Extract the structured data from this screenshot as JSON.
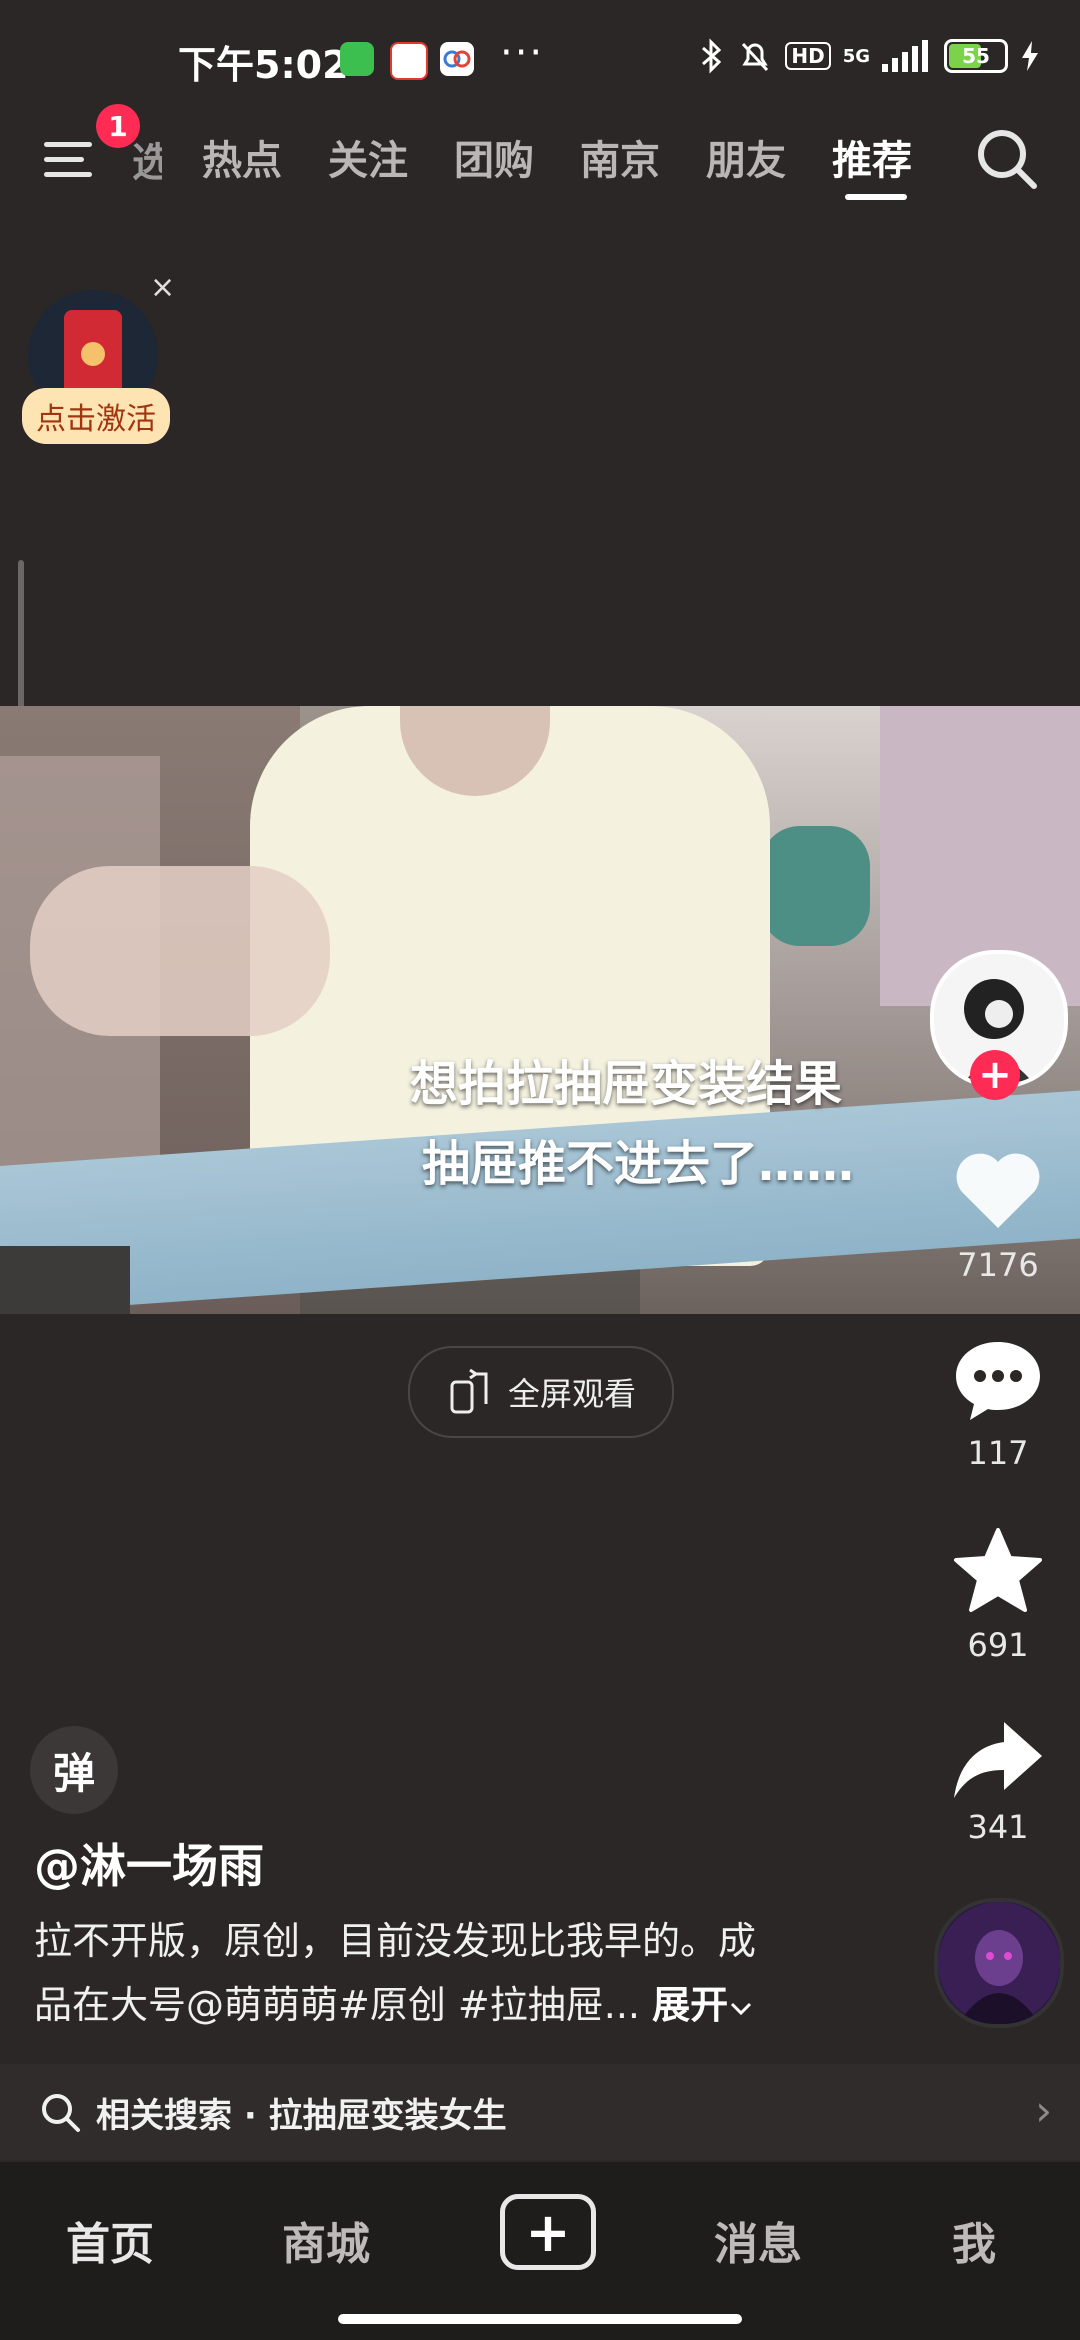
{
  "status_bar": {
    "time": "下午5:02",
    "more_dots": "···",
    "network": "5G",
    "hd_badge": "HD",
    "battery": "55"
  },
  "top_nav": {
    "menu_badge": "1",
    "clipped_tab": "选",
    "tabs": [
      "热点",
      "关注",
      "团购",
      "南京",
      "朋友",
      "推荐"
    ],
    "active_tab": "推荐"
  },
  "promo": {
    "close": "×",
    "label": "点击激活"
  },
  "video": {
    "caption_line_1": "想拍拉抽屉变装结果",
    "caption_line_2": "抽屉推不进去了……"
  },
  "fullscreen": {
    "label": "全屏观看"
  },
  "rail": {
    "likes": "7176",
    "comments": "117",
    "favorites": "691",
    "shares": "341",
    "follow_plus": "+"
  },
  "post": {
    "danmaku": "弹",
    "author": "@淋一场雨",
    "desc_line_1": "拉不开版，原创，目前没发现比我早的。成",
    "desc_line_2": "品在大号@萌萌萌#原创 #拉抽屉...",
    "expand": "展开"
  },
  "related_search": {
    "text": "相关搜索 · 拉抽屉变装女生",
    "chevron": "›"
  },
  "bottom_nav": {
    "home": "首页",
    "mall": "商城",
    "plus": "+",
    "messages": "消息",
    "me": "我"
  },
  "colors": {
    "background": "#2a2726",
    "accent": "#fe2c55",
    "promo_label_bg": "#ffe4b3"
  }
}
